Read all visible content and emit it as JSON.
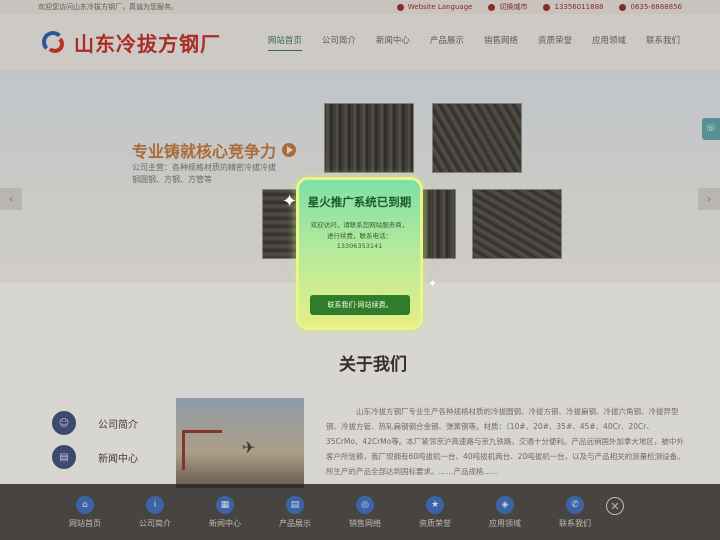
{
  "topbar": {
    "welcome": "欢迎您访问山东冷拔方钢厂，真诚为您服务。",
    "language": "Website Language",
    "switch_city": "切换城市",
    "phone1": "13356011888",
    "phone2": "0635-8888856"
  },
  "header": {
    "logo_text": "山东冷拔方钢厂",
    "nav": [
      "网站首页",
      "公司简介",
      "新闻中心",
      "产品展示",
      "销售网络",
      "资质荣誉",
      "应用领域",
      "联系我们"
    ]
  },
  "banner": {
    "slogan": "专业铸就核心竞争力",
    "sub": "公司主营：各种规格材质的精密冷拔冷拔钢圆钢、方钢、方管等"
  },
  "about": {
    "title": "关于我们",
    "side_menu": [
      "公司简介",
      "新闻中心"
    ],
    "text": "山东冷拔方钢厂专业生产各种规格材质的冷拔圆钢、冷拔方钢、冷拔扁钢、冷拔六角钢、冷拔异型钢、冷拔方管、热轧扁钢钢合金钢、弹簧钢等。材质：（10#、20#、35#、45#、40Cr、20Cr、35CrMo、42CrMo等。本厂紧邻京沪高速路与京九铁路，交通十分便利。产品远销国外加拿大地区，被中外客户所信赖，我厂现拥有60吨拔机一台、40吨拔机两台、20吨拔机一台，以及与产品相关的测量检测设备。所生产的产品全部达到国标要求。……产品规格……"
  },
  "bottombar": {
    "items": [
      "网站首页",
      "公司简介",
      "新闻中心",
      "产品展示",
      "销售网络",
      "资质荣誉",
      "应用领域",
      "联系我们"
    ]
  },
  "modal": {
    "title": "星火推广系统已到期",
    "body_line1": "欢迎访问，请联系您网站服务商，",
    "body_line2": "进行续费，联系电话：",
    "phone": "13306353141",
    "button": "联系我们·网站续费。"
  },
  "colors": {
    "brand_red": "#b72e25",
    "modal_button": "#2f7d2a",
    "nav_active": "#3d6f4a"
  }
}
